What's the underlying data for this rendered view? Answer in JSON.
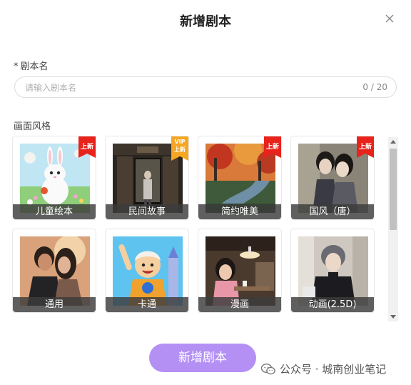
{
  "dialog": {
    "title": "新增剧本",
    "close_icon": "close-icon"
  },
  "name_field": {
    "required_mark": "*",
    "label": "剧本名",
    "placeholder": "请输入剧本名",
    "value": "",
    "counter": "0 / 20"
  },
  "style_section": {
    "label": "画面风格",
    "cards": [
      {
        "name": "儿童绘本",
        "tag": "上新",
        "tag_type": "new",
        "image": "white bunny rabbit illustration"
      },
      {
        "name": "民间故事",
        "tag": "VIP\n上新",
        "tag_type": "vip",
        "image": "girl standing at dark wooden doorway"
      },
      {
        "name": "简约唯美",
        "tag": "上新",
        "tag_type": "new",
        "image": "autumn forest stream landscape"
      },
      {
        "name": "国风（唐）",
        "tag": "上新",
        "tag_type": "new",
        "image": "two figures in traditional chinese attire"
      },
      {
        "name": "通用",
        "tag": "",
        "tag_type": "",
        "image": "couple portrait at sunset"
      },
      {
        "name": "卡通",
        "tag": "",
        "tag_type": "",
        "image": "cartoon boy waving"
      },
      {
        "name": "漫画",
        "tag": "",
        "tag_type": "",
        "image": "girl sitting in cafe"
      },
      {
        "name": "动画(2.5D)",
        "tag": "",
        "tag_type": "",
        "image": "young man in black sweater"
      }
    ]
  },
  "submit_button": {
    "label": "新增剧本"
  },
  "watermark": {
    "text": "公众号 · 城南创业笔记",
    "icon": "wechat-icon"
  },
  "colors": {
    "accent": "#b490f5",
    "tag_new": "#e8231c",
    "tag_vip": "#f5a623",
    "caption_bg": "#3c3c3c"
  }
}
